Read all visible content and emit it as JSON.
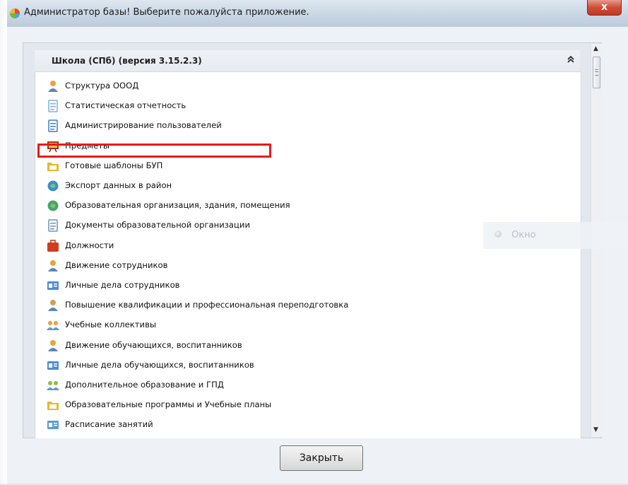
{
  "window": {
    "title": "Администратор базы! Выберите пожалуйста приложение.",
    "close_label": "x"
  },
  "group": {
    "title": "Школа (СПб) (версия 3.15.2.3)",
    "collapse_glyph": "«"
  },
  "items": [
    {
      "label": "Структура ОООД",
      "icon": "person-icon",
      "color": "#e8a33a"
    },
    {
      "label": "Статистическая отчетность",
      "icon": "report-icon",
      "color": "#7ab0d8"
    },
    {
      "label": "Администрирование пользователей",
      "icon": "admin-users-icon",
      "color": "#3d7fc1"
    },
    {
      "label": "Предметы",
      "icon": "board-icon",
      "color": "#b22a1c"
    },
    {
      "label": "Готовые шаблоны БУП",
      "icon": "folder-template-icon",
      "color": "#e9b82e"
    },
    {
      "label": "Экспорт данных в район",
      "icon": "globe-export-icon",
      "color": "#3c8ec9"
    },
    {
      "label": "Образовательная организация, здания, помещения",
      "icon": "building-icon",
      "color": "#4aa36b"
    },
    {
      "label": "Документы образовательной организации",
      "icon": "document-icon",
      "color": "#6f93bd"
    },
    {
      "label": "Должности",
      "icon": "briefcase-icon",
      "color": "#d23b1f"
    },
    {
      "label": "Движение сотрудников",
      "icon": "person-move-icon",
      "color": "#e8a33a"
    },
    {
      "label": "Личные дела сотрудников",
      "icon": "card-icon",
      "color": "#4d8fcc"
    },
    {
      "label": "Повышение квалификации и профессиональная переподготовка",
      "icon": "person-grad-icon",
      "color": "#c9a255"
    },
    {
      "label": "Учебные коллективы",
      "icon": "group-icon",
      "color": "#e8a33a"
    },
    {
      "label": "Движение обучающихся, воспитанников",
      "icon": "student-icon",
      "color": "#e8a33a"
    },
    {
      "label": "Личные дела обучающихся, воспитанников",
      "icon": "card-icon",
      "color": "#4d8fcc"
    },
    {
      "label": "Дополнительное образование и ГПД",
      "icon": "group-icon",
      "color": "#8cbf3a"
    },
    {
      "label": "Образовательные программы и Учебные планы",
      "icon": "folder-star-icon",
      "color": "#e9b82e"
    },
    {
      "label": "Расписание занятий",
      "icon": "schedule-icon",
      "color": "#5d9bd0"
    }
  ],
  "ghost_window": {
    "label": "Окно"
  },
  "footer": {
    "close_button": "Закрыть"
  },
  "colors": {
    "highlight": "#e81b1b",
    "titlebar": "#c9d6e4",
    "close": "#c03a24"
  }
}
